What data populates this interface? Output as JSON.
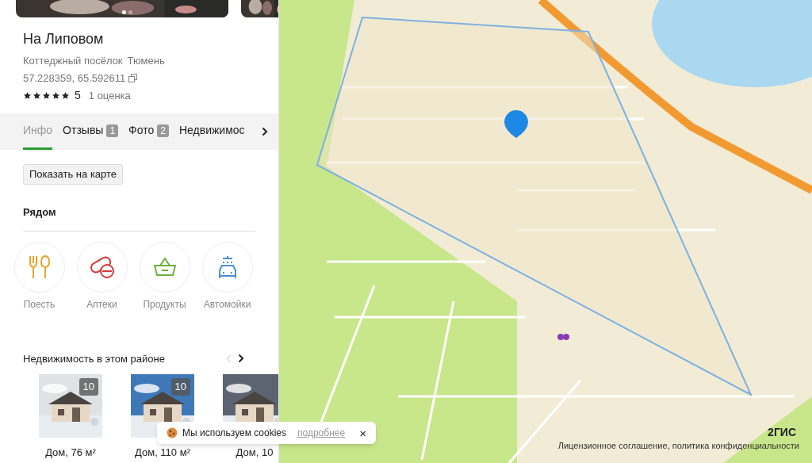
{
  "gallery": {
    "dots": [
      {
        "selected": true
      },
      {
        "selected": false
      }
    ]
  },
  "place": {
    "title": "На Липовом",
    "category": "Коттеджный посёлок",
    "city": "Тюмень",
    "coords": "57.228359, 65.592611",
    "stars": 5,
    "rating": "5",
    "reviews": "1 оценка"
  },
  "tabs": [
    {
      "label": "Инфо",
      "selected": true
    },
    {
      "label": "Отзывы",
      "count": "1",
      "selected": false
    },
    {
      "label": "Фото",
      "count": "2",
      "selected": false
    },
    {
      "label": "Недвижимос",
      "selected": false
    }
  ],
  "show_on_map": "Показать на карте",
  "nearby": {
    "title": "Рядом",
    "items": [
      {
        "kind": "food",
        "label": "Поесть"
      },
      {
        "kind": "pharmacy",
        "label": "Аптеки"
      },
      {
        "kind": "grocery",
        "label": "Продукты"
      },
      {
        "kind": "carwash",
        "label": "Автомойки"
      }
    ]
  },
  "realty": {
    "title": "Недвижимость в этом районе",
    "cards": [
      {
        "count": "10",
        "caption": "Дом, 76 м²"
      },
      {
        "count": "10",
        "caption": "Дом, 110 м²"
      },
      {
        "caption": "Дом, 10"
      }
    ]
  },
  "cookie_banner": {
    "text": "Мы используем cookies",
    "link": "подробнее",
    "close": "×"
  },
  "map": {
    "kind": "picture",
    "logo": "2ГИС",
    "license": "Лицензионное соглашение, политика конфиденциальности"
  }
}
